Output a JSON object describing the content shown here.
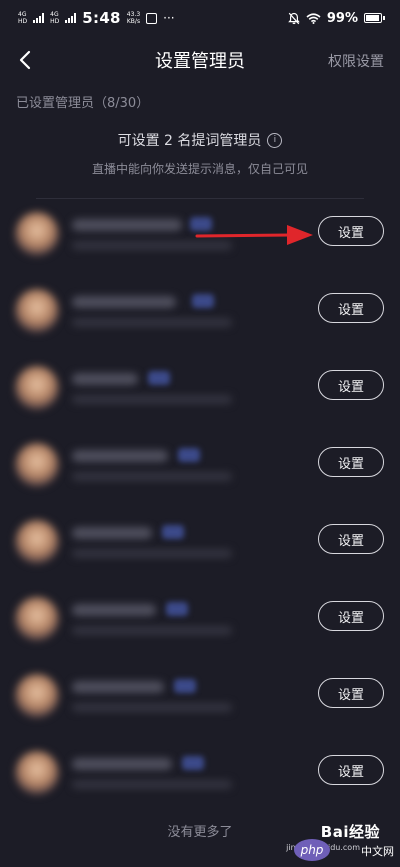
{
  "status_bar": {
    "network_1": "4G",
    "network_2": "4G",
    "time": "5:48",
    "speed_value": "43.3",
    "speed_unit": "KB/s",
    "more": "···",
    "battery": "99%"
  },
  "nav": {
    "title": "设置管理员",
    "right_link": "权限设置"
  },
  "admin_count": "已设置管理员（8/30）",
  "info": {
    "main": "可设置 2 名提词管理员",
    "sub": "直播中能向你发送提示消息，仅自己可见"
  },
  "list": {
    "button_label": "设置",
    "items": [
      {
        "button": "设置",
        "highlighted": true
      },
      {
        "button": "设置"
      },
      {
        "button": "设置"
      },
      {
        "button": "设置"
      },
      {
        "button": "设置"
      },
      {
        "button": "设置"
      },
      {
        "button": "设置"
      },
      {
        "button": "设置"
      }
    ]
  },
  "footer": "没有更多了",
  "watermark": {
    "brand": "Bai经验",
    "sub": "jingyan.baidu.com",
    "badge": "php",
    "cn": "中文网"
  },
  "colors": {
    "background": "#1c1c26",
    "annotation_arrow": "#e0262b"
  }
}
